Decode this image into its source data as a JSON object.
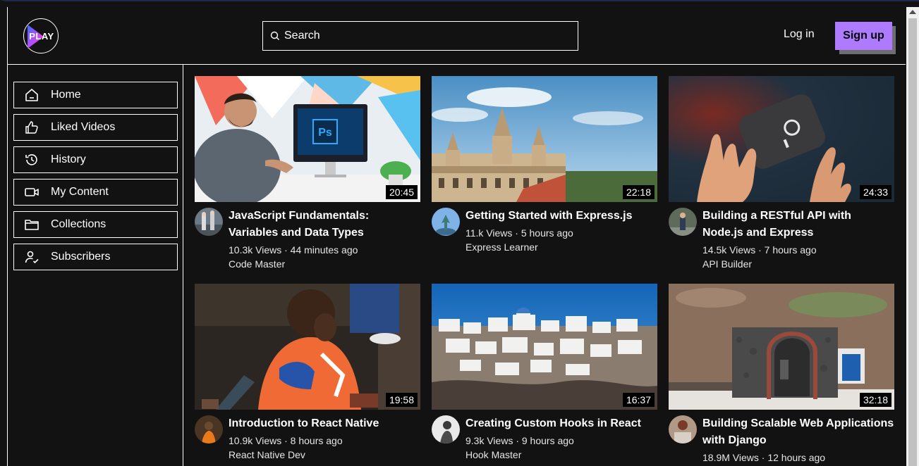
{
  "app": {
    "logo_text": "PLAY"
  },
  "header": {
    "search_placeholder": "Search",
    "login_label": "Log in",
    "signup_label": "Sign up"
  },
  "sidebar": {
    "items": [
      {
        "label": "Home",
        "icon": "home-icon"
      },
      {
        "label": "Liked Videos",
        "icon": "thumbs-up-icon"
      },
      {
        "label": "History",
        "icon": "history-icon"
      },
      {
        "label": "My Content",
        "icon": "video-camera-icon"
      },
      {
        "label": "Collections",
        "icon": "folder-icon"
      },
      {
        "label": "Subscribers",
        "icon": "user-check-icon"
      }
    ]
  },
  "videos": [
    {
      "title": "JavaScript Fundamentals: Variables and Data Types",
      "duration": "20:45",
      "stats": "10.3k Views · 44 minutes ago",
      "channel": "Code Master"
    },
    {
      "title": "Getting Started with Express.js",
      "duration": "22:18",
      "stats": "11.k Views · 5 hours ago",
      "channel": "Express Learner"
    },
    {
      "title": "Building a RESTful API with Node.js and Express",
      "duration": "24:33",
      "stats": "14.5k Views · 7 hours ago",
      "channel": "API Builder"
    },
    {
      "title": "Introduction to React Native",
      "duration": "19:58",
      "stats": "10.9k Views · 8 hours ago",
      "channel": "React Native Dev"
    },
    {
      "title": "Creating Custom Hooks in React",
      "duration": "16:37",
      "stats": "9.3k Views · 9 hours ago",
      "channel": "Hook Master"
    },
    {
      "title": "Building Scalable Web Applications with Django",
      "duration": "32:18",
      "stats": "18.9M Views · 12 hours ago",
      "channel": ""
    }
  ],
  "colors": {
    "background": "#121212",
    "accent": "#ae7aff",
    "border": "#ffffff"
  }
}
